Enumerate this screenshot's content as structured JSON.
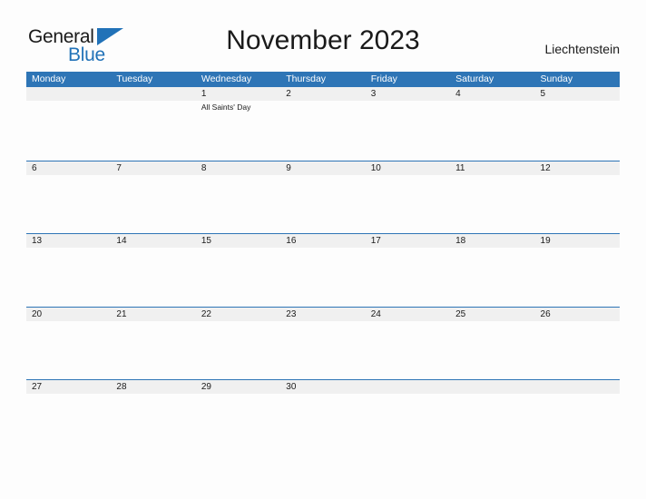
{
  "brand": {
    "name_part1": "General",
    "name_part2": "Blue",
    "accent_color": "#2172b8"
  },
  "header": {
    "title": "November 2023",
    "region": "Liechtenstein"
  },
  "theme": {
    "header_blue": "#2e75b6",
    "row_band_gray": "#f0f0f0",
    "rule_blue": "#2e75b6",
    "page_background": "#fdfdfd",
    "text_color": "#1a1a1a"
  },
  "calendar": {
    "month": "November",
    "year": "2023",
    "weekday_headers": [
      "Monday",
      "Tuesday",
      "Wednesday",
      "Thursday",
      "Friday",
      "Saturday",
      "Sunday"
    ],
    "weeks": [
      {
        "ruled": false,
        "days": [
          {
            "number": "",
            "events": []
          },
          {
            "number": "",
            "events": []
          },
          {
            "number": "1",
            "events": [
              "All Saints' Day"
            ]
          },
          {
            "number": "2",
            "events": []
          },
          {
            "number": "3",
            "events": []
          },
          {
            "number": "4",
            "events": []
          },
          {
            "number": "5",
            "events": []
          }
        ]
      },
      {
        "ruled": true,
        "days": [
          {
            "number": "6",
            "events": []
          },
          {
            "number": "7",
            "events": []
          },
          {
            "number": "8",
            "events": []
          },
          {
            "number": "9",
            "events": []
          },
          {
            "number": "10",
            "events": []
          },
          {
            "number": "11",
            "events": []
          },
          {
            "number": "12",
            "events": []
          }
        ]
      },
      {
        "ruled": true,
        "days": [
          {
            "number": "13",
            "events": []
          },
          {
            "number": "14",
            "events": []
          },
          {
            "number": "15",
            "events": []
          },
          {
            "number": "16",
            "events": []
          },
          {
            "number": "17",
            "events": []
          },
          {
            "number": "18",
            "events": []
          },
          {
            "number": "19",
            "events": []
          }
        ]
      },
      {
        "ruled": true,
        "days": [
          {
            "number": "20",
            "events": []
          },
          {
            "number": "21",
            "events": []
          },
          {
            "number": "22",
            "events": []
          },
          {
            "number": "23",
            "events": []
          },
          {
            "number": "24",
            "events": []
          },
          {
            "number": "25",
            "events": []
          },
          {
            "number": "26",
            "events": []
          }
        ]
      },
      {
        "ruled": true,
        "days": [
          {
            "number": "27",
            "events": []
          },
          {
            "number": "28",
            "events": []
          },
          {
            "number": "29",
            "events": []
          },
          {
            "number": "30",
            "events": []
          },
          {
            "number": "",
            "events": []
          },
          {
            "number": "",
            "events": []
          },
          {
            "number": "",
            "events": []
          }
        ]
      }
    ]
  }
}
